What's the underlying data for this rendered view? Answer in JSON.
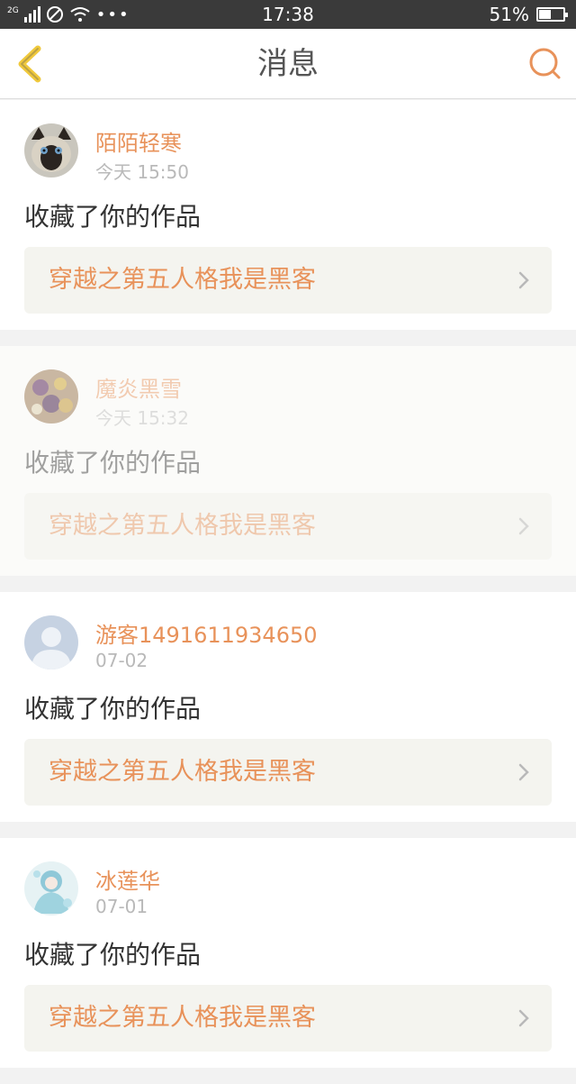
{
  "status_bar": {
    "network": "2G",
    "time": "17:38",
    "battery_text": "51%",
    "battery_level": 0.51
  },
  "nav": {
    "title": "消息",
    "back_icon": "chevron-left-icon",
    "search_icon": "search-icon",
    "accent_color": "#e8925a",
    "back_color": "#f0c93c"
  },
  "messages": [
    {
      "username": "陌陌轻寒",
      "time": "今天 15:50",
      "action": "收藏了你的作品",
      "work_title": "穿越之第五人格我是黑客",
      "avatar": "cat-avatar"
    },
    {
      "username": "魔炎黑雪",
      "time": "今天 15:32",
      "action": "收藏了你的作品",
      "work_title": "穿越之第五人格我是黑客",
      "avatar": "flower-avatar"
    },
    {
      "username": "游客1491611934650",
      "time": "07-02",
      "action": "收藏了你的作品",
      "work_title": "穿越之第五人格我是黑客",
      "avatar": "default-user-avatar"
    },
    {
      "username": "冰莲华",
      "time": "07-01",
      "action": "收藏了你的作品",
      "work_title": "穿越之第五人格我是黑客",
      "avatar": "anime-avatar"
    }
  ]
}
